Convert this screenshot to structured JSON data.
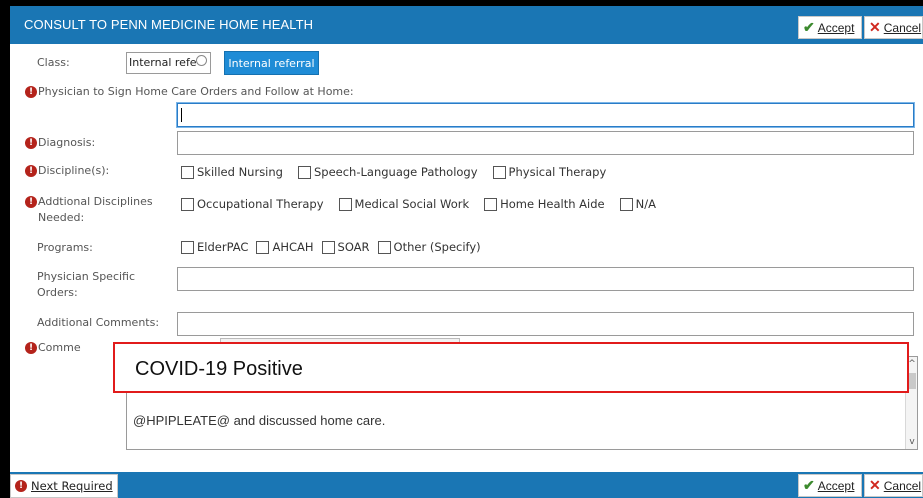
{
  "window": {
    "title": "CONSULT TO PENN MEDICINE HOME HEALTH"
  },
  "header": {
    "accept_label": "Accept",
    "cancel_label": "Cancel"
  },
  "form": {
    "class": {
      "label": "Class:",
      "value": "Internal refe",
      "button_label": "Internal referral"
    },
    "physician": {
      "label": "Physician to Sign Home Care Orders and Follow at Home:"
    },
    "diagnosis": {
      "label": "Diagnosis:"
    },
    "disciplines": {
      "label": "Discipline(s):",
      "options": [
        "Skilled Nursing",
        "Speech-Language Pathology",
        "Physical Therapy"
      ]
    },
    "additional_disciplines": {
      "label_line1": "Addtional Disciplines",
      "label_line2": "Needed:",
      "options": [
        "Occupational Therapy",
        "Medical Social Work",
        "Home Health Aide",
        "N/A"
      ]
    },
    "programs": {
      "label": "Programs:",
      "options": [
        "ElderPAC",
        "AHCAH",
        "SOAR",
        "Other (Specify)"
      ]
    },
    "physician_orders": {
      "label_line1": "Physician Specific",
      "label_line2": "Orders:"
    },
    "additional_comments": {
      "label": "Additional Comments:"
    },
    "comments": {
      "label": "Comme",
      "partial_text": "@HPIPLEATE@ and discussed home care."
    }
  },
  "overlay": {
    "text": "COVID-19 Positive"
  },
  "footer": {
    "next_required_label": "Next Required",
    "accept_label": "Accept",
    "cancel_label": "Cancel"
  },
  "colors": {
    "titlebar": "#1a76b4",
    "required": "#b4231b",
    "accent_button": "#1f8cd6",
    "overlay_border": "#e11b1b"
  }
}
